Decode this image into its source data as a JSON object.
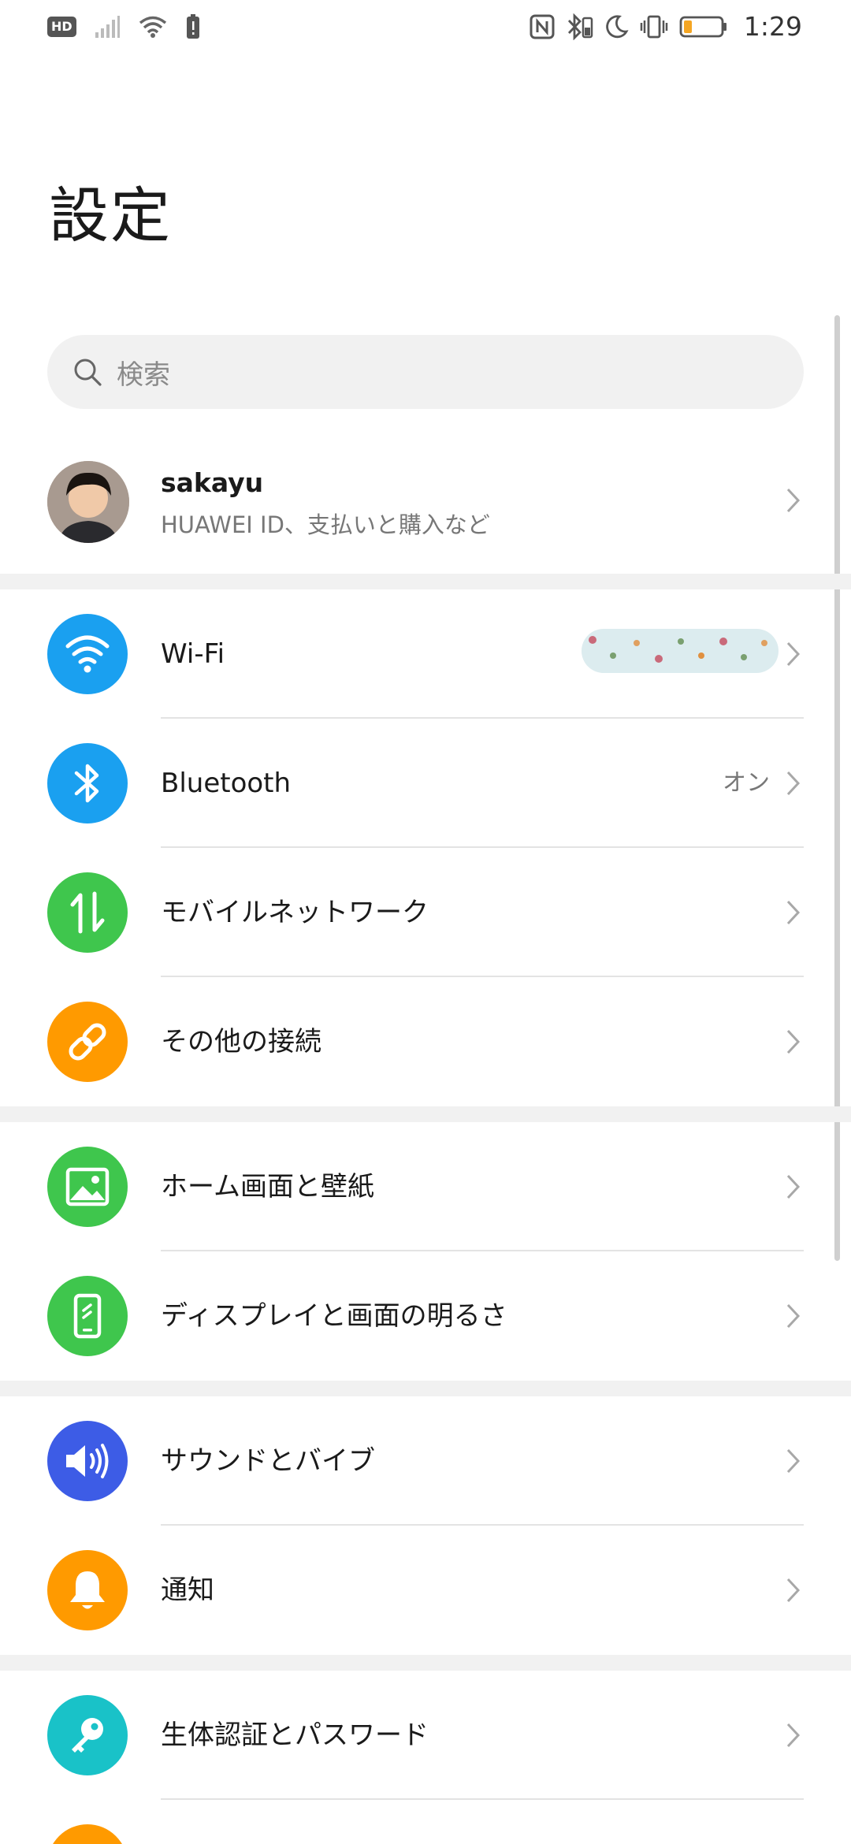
{
  "status_bar": {
    "hd_label": "HD",
    "time": "1:29",
    "battery_color": "#f5a623",
    "icons": [
      "hd-icon",
      "signal-icon",
      "wifi-icon",
      "alert-icon",
      "nfc-icon",
      "bluetooth-icon",
      "moon-icon",
      "vibrate-icon",
      "battery-icon"
    ]
  },
  "title": "設定",
  "search": {
    "placeholder": "検索"
  },
  "account": {
    "name": "sakayu",
    "subtitle": "HUAWEI ID、支払いと購入など"
  },
  "sections": [
    {
      "items": [
        {
          "label": "Wi-Fi",
          "icon": "wifi-icon",
          "color": "#1aa0f0",
          "value": ""
        },
        {
          "label": "Bluetooth",
          "icon": "bluetooth-icon",
          "color": "#1aa0f0",
          "value": "オン"
        },
        {
          "label": "モバイルネットワーク",
          "icon": "data-arrows-icon",
          "color": "#3fc64d",
          "value": ""
        },
        {
          "label": "その他の接続",
          "icon": "link-icon",
          "color": "#ff9a00",
          "value": ""
        }
      ]
    },
    {
      "items": [
        {
          "label": "ホーム画面と壁紙",
          "icon": "image-icon",
          "color": "#3fc64d"
        },
        {
          "label": "ディスプレイと画面の明るさ",
          "icon": "phone-brightness-icon",
          "color": "#3fc64d"
        }
      ]
    },
    {
      "items": [
        {
          "label": "サウンドとバイブ",
          "icon": "speaker-icon",
          "color": "#3d5ce6"
        },
        {
          "label": "通知",
          "icon": "bell-icon",
          "color": "#ff9a00"
        }
      ]
    },
    {
      "items": [
        {
          "label": "生体認証とパスワード",
          "icon": "key-icon",
          "color": "#19c2c8"
        }
      ]
    }
  ]
}
